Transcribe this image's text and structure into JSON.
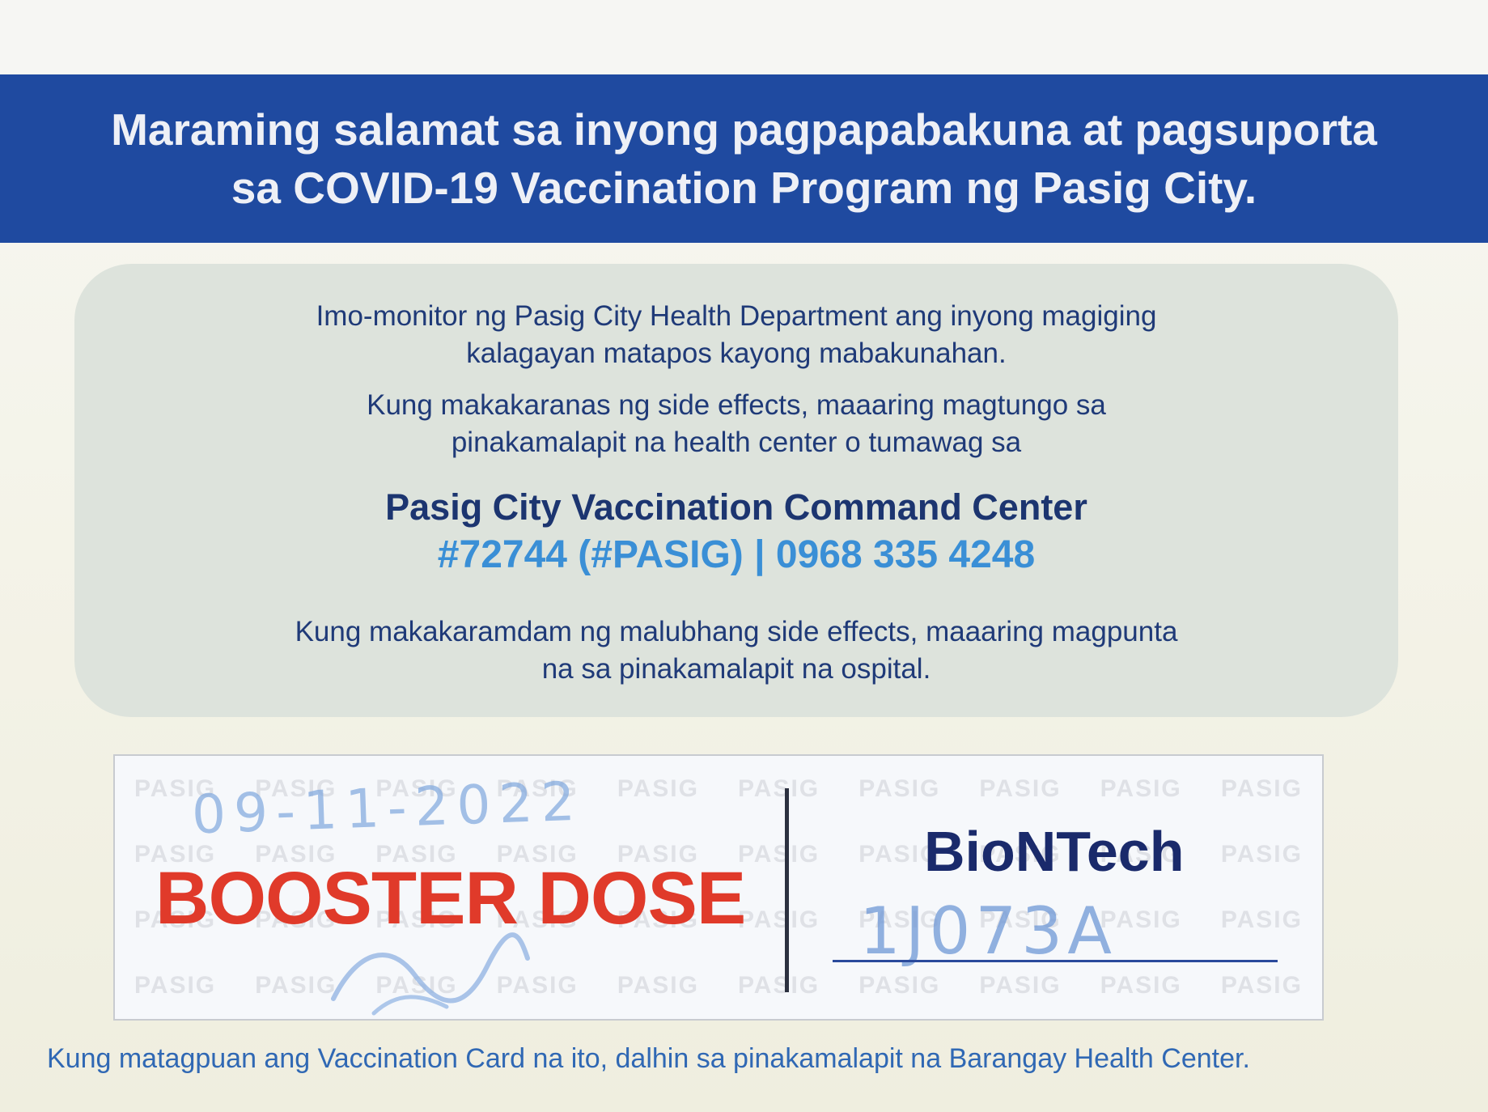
{
  "header": {
    "line1": "Maraming salamat sa inyong pagpapabakuna at pagsuporta",
    "line2": "sa COVID-19 Vaccination Program ng Pasig City."
  },
  "info": {
    "monitor_line1": "Imo-monitor ng Pasig City Health Department ang inyong magiging",
    "monitor_line2": "kalagayan matapos kayong mabakunahan.",
    "side_effects_line1": "Kung makakaranas ng side effects, maaaring magtungo sa",
    "side_effects_line2": "pinakamalapit na health center o tumawag sa",
    "command_center": "Pasig City Vaccination Command Center",
    "hotline": "#72744 (#PASIG) | 0968 335 4248",
    "severe_line1": "Kung makakaramdam ng malubhang side effects, maaaring magpunta",
    "severe_line2": "na sa pinakamalapit na ospital."
  },
  "dose": {
    "label": "BOOSTER DOSE",
    "date_handwritten": "09-11-2022",
    "vaccine": "BioNTech",
    "lot_handwritten": "1J073A",
    "watermark_text": "PASIG",
    "colors": {
      "booster": "#e03a2a",
      "vaccine": "#1a2a6b",
      "ink": "#7fa8de"
    }
  },
  "footer": {
    "text": "Kung matagpuan ang Vaccination Card na ito, dalhin sa pinakamalapit na Barangay Health Center."
  },
  "colors": {
    "header_bg": "#1f4aa0",
    "info_bg": "#dde3dc",
    "phone": "#3a8fd6"
  }
}
